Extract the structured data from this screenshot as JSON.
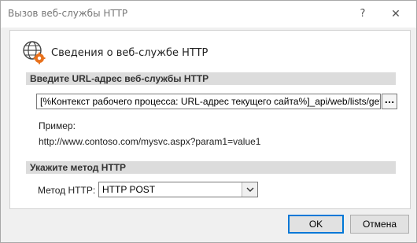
{
  "window": {
    "title": "Вызов веб-службы HTTP",
    "help_label": "?",
    "close_label": "✕"
  },
  "header": {
    "icon": "globe-gear-icon",
    "title": "Сведения о веб-службе HTTP"
  },
  "url_section": {
    "heading": "Введите URL-адрес веб-службы HTTP",
    "url_value": "[%Контекст рабочего процесса: URL-адрес текущего сайта%]_api/web/lists/getbytitle",
    "browse_label": "...",
    "example_label": "Пример:",
    "example_value": "http://www.contoso.com/mysvc.aspx?param1=value1"
  },
  "method_section": {
    "heading": "Укажите метод HTTP",
    "method_label": "Метод HTTP:",
    "method_value": "HTTP POST"
  },
  "buttons": {
    "ok": "OK",
    "cancel": "Отмена"
  },
  "colors": {
    "accent": "#0078d7",
    "section_bar": "#dcdcdc",
    "icon_orange": "#e8711c"
  }
}
